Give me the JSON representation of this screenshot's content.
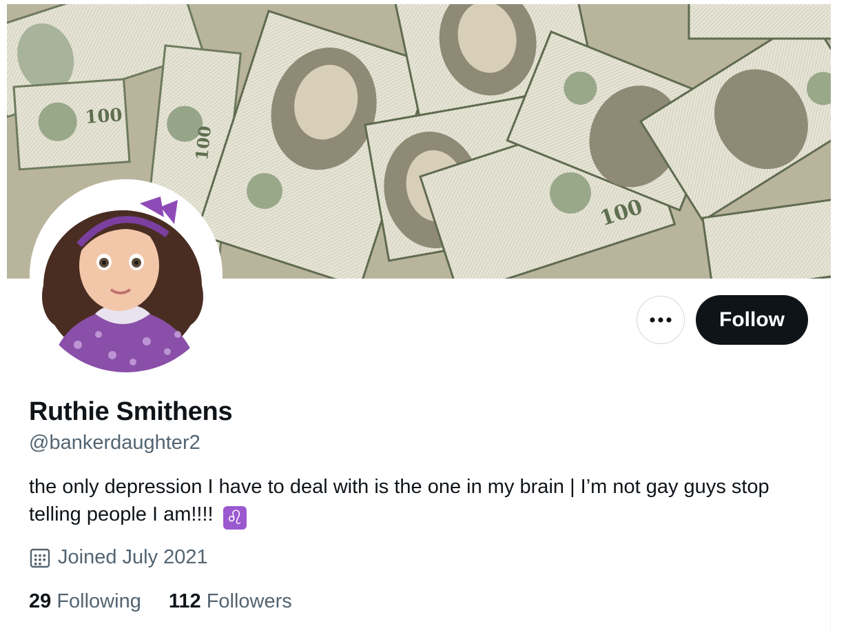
{
  "profile": {
    "display_name": "Ruthie Smithens",
    "handle": "@bankerdaughter2",
    "bio": "the only depression I have to deal with is the one in my brain | I’m not gay guys stop telling people I am!!!!",
    "bio_emoji": "♌",
    "joined": "Joined July 2021",
    "following_count": "29",
    "following_label": "Following",
    "followers_count": "112",
    "followers_label": "Followers"
  },
  "actions": {
    "follow_label": "Follow",
    "more_icon": "more-dots-icon"
  },
  "banner": {
    "description_icon": "money-banner",
    "bill_text": "100"
  },
  "colors": {
    "primary_text": "#0f1419",
    "secondary_text": "#536471",
    "follow_bg": "#0f1419",
    "border": "#cfd9de",
    "zodiac": "#9b59d0"
  }
}
